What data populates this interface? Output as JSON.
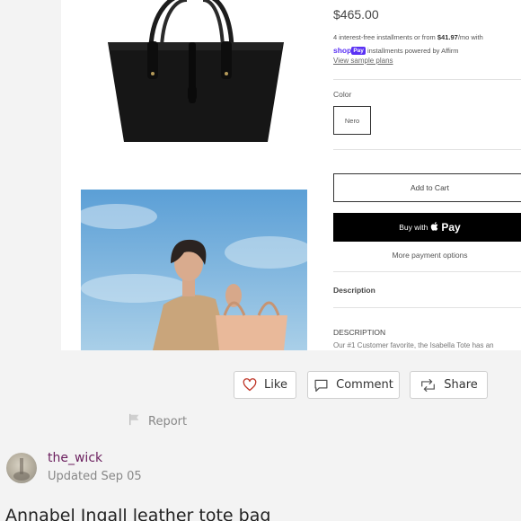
{
  "product": {
    "price": "$465.00",
    "installments_prefix": "4 interest-free installments or from ",
    "installments_amount": "$41.97",
    "installments_suffix": "/mo with",
    "shop_pay_shop": "shop",
    "shop_pay_badge": "Pay",
    "installments_powered": " installments powered by Affirm",
    "view_plans": "View sample plans",
    "color_label": "Color",
    "color_option": "Nero",
    "add_to_cart": "Add to Cart",
    "buy_with": "Buy with",
    "apple_pay": "Pay",
    "more_payment": "More payment options",
    "description_heading": "Description",
    "description_caps": "DESCRIPTION",
    "description_text": "Our #1 Customer favorite, the Isabella Tote has an"
  },
  "actions": {
    "like": "Like",
    "comment": "Comment",
    "share": "Share",
    "report": "Report"
  },
  "author": {
    "username": "the_wick",
    "updated": "Updated Sep 05"
  },
  "listing": {
    "title": "Annabel Ingall leather tote bag"
  },
  "colors": {
    "username": "#6b1f5e",
    "like_heart": "#c0392b",
    "shop_pay": "#5a31f4"
  },
  "icons": [
    "heart-icon",
    "comment-icon",
    "repost-icon",
    "flag-icon",
    "apple-icon"
  ]
}
